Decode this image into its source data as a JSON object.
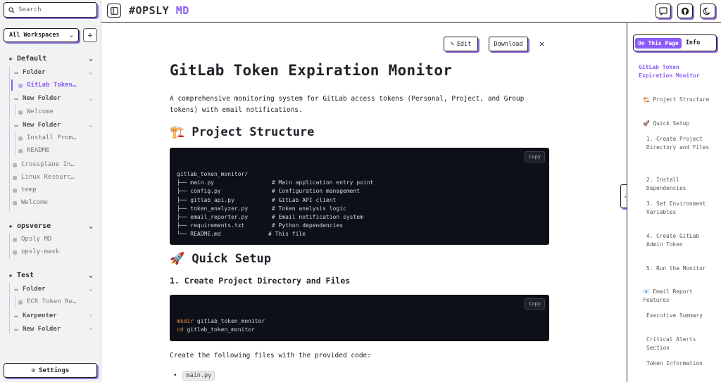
{
  "sidebar": {
    "search_placeholder": "Search",
    "workspace_select": "All Workspaces",
    "add_label": "+",
    "settings_label": "Settings",
    "workspaces": [
      {
        "name": "Default",
        "items": [
          {
            "label": "Folder",
            "type": "folder"
          },
          {
            "label": "GitLab Token…",
            "type": "file",
            "active": true
          },
          {
            "label": "New Folder",
            "type": "folder"
          },
          {
            "label": "Welcome",
            "type": "file"
          },
          {
            "label": "New Folder",
            "type": "folder"
          },
          {
            "label": "Install Prom…",
            "type": "file"
          },
          {
            "label": "README",
            "type": "file"
          },
          {
            "label": "Crossplane In…",
            "type": "file"
          },
          {
            "label": "Linux Resourc…",
            "type": "file"
          },
          {
            "label": "temp",
            "type": "file"
          },
          {
            "label": "Welcome",
            "type": "file"
          }
        ]
      },
      {
        "name": "opsverse",
        "items": [
          {
            "label": "Opsly MD",
            "type": "file"
          },
          {
            "label": "opsly-mask",
            "type": "file"
          }
        ]
      },
      {
        "name": "Test",
        "items": [
          {
            "label": "Folder",
            "type": "folder"
          },
          {
            "label": "ECR Token Re…",
            "type": "file"
          },
          {
            "label": "Karpenter",
            "type": "folder"
          },
          {
            "label": "New Folder",
            "type": "folder"
          }
        ]
      }
    ]
  },
  "header": {
    "brand_hash": "#OPSLY",
    "brand_md": "MD"
  },
  "doc": {
    "edit_label": "Edit",
    "download_label": "Download",
    "close_glyph": "✕",
    "title": "GitLab Token Expiration Monitor",
    "intro": "A comprehensive monitoring system for GitLab access tokens (Personal, Project, and Group tokens) with email notifications.",
    "h_structure": "🏗️ Project Structure",
    "copy_label": "Copy",
    "structure_code": "gitlab_token_monitor/\n├── main.py                 # Main application entry point\n├── config.py               # Configuration management\n├── gitlab_api.py           # GitLab API client\n├── token_analyzer.py       # Token analysis logic\n├── email_reporter.py       # Email notification system\n├── requirements.txt        # Python dependencies\n└── README.md              # This file",
    "h_quick": "🚀 Quick Setup",
    "h_step1": "1. Create Project Directory and Files",
    "cmd1_keyword": "mkdir",
    "cmd1_arg": " gitlab_token_monitor",
    "cmd2_keyword": "cd",
    "cmd2_arg": " gitlab_token_monitor",
    "create_files_text": "Create the following files with the provided code:",
    "first_file": "main.py"
  },
  "toc": {
    "tab_active": "On This Page",
    "tab_inactive": "Info",
    "title": "GitLab Token Expiration Monitor",
    "items": [
      "🏗️ Project Structure",
      "🚀 Quick Setup",
      "1. Create Project Directory and Files",
      "2. Install Dependencies",
      "3. Set Environment Variables",
      "4. Create GitLab Admin Token",
      "5. Run the Monitor",
      "📧 Email Report Features",
      "Executive Summary",
      "Critical Alerts Section",
      "Token Information"
    ]
  },
  "colors": {
    "accent": "#8b5cf6",
    "shadow": "#8b6bd3",
    "code_bg": "#0d1117"
  }
}
